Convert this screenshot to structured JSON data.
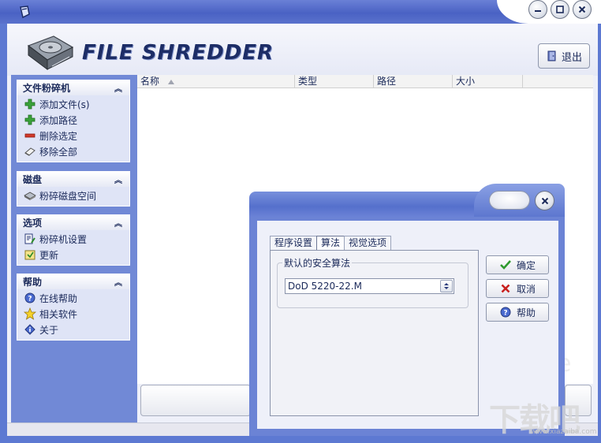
{
  "app": {
    "logo_text": "FILE SHREDDER",
    "exit_label": "退出"
  },
  "window_controls": [
    "minimize-icon",
    "maximize-icon",
    "close-icon"
  ],
  "sidebar": {
    "groups": [
      {
        "title": "文件粉碎机",
        "items": [
          {
            "label": "添加文件(s)",
            "icon": "plus-icon"
          },
          {
            "label": "添加路径",
            "icon": "plus-icon"
          },
          {
            "label": "删除选定",
            "icon": "minus-icon"
          },
          {
            "label": "移除全部",
            "icon": "eraser-icon"
          }
        ]
      },
      {
        "title": "磁盘",
        "items": [
          {
            "label": "粉碎磁盘空间",
            "icon": "disk-icon"
          }
        ]
      },
      {
        "title": "选项",
        "items": [
          {
            "label": "粉碎机设置",
            "icon": "settings-icon"
          },
          {
            "label": "更新",
            "icon": "update-icon"
          }
        ]
      },
      {
        "title": "帮助",
        "items": [
          {
            "label": "在线帮助",
            "icon": "help-icon"
          },
          {
            "label": "相关软件",
            "icon": "star-icon"
          },
          {
            "label": "关于",
            "icon": "info-icon"
          }
        ]
      }
    ]
  },
  "list": {
    "columns": [
      "名称",
      "类型",
      "路径",
      "大小"
    ]
  },
  "dialog": {
    "tabs": [
      "程序设置",
      "算法",
      "视觉选项"
    ],
    "active_tab": "算法",
    "group_label": "默认的安全算法",
    "algorithm_value": "DoD 5220-22.M",
    "buttons": {
      "ok": "确定",
      "cancel": "取消",
      "help": "帮助"
    }
  },
  "watermark": {
    "logo": "下载吧",
    "url": "www.xiazaiba.com"
  },
  "colors": {
    "frame_blue": "#5d79d2",
    "panel_blue": "#7189d6",
    "text_dark": "#1b2a5a",
    "ok_green": "#2e9a2e",
    "cancel_red": "#c8201e"
  }
}
